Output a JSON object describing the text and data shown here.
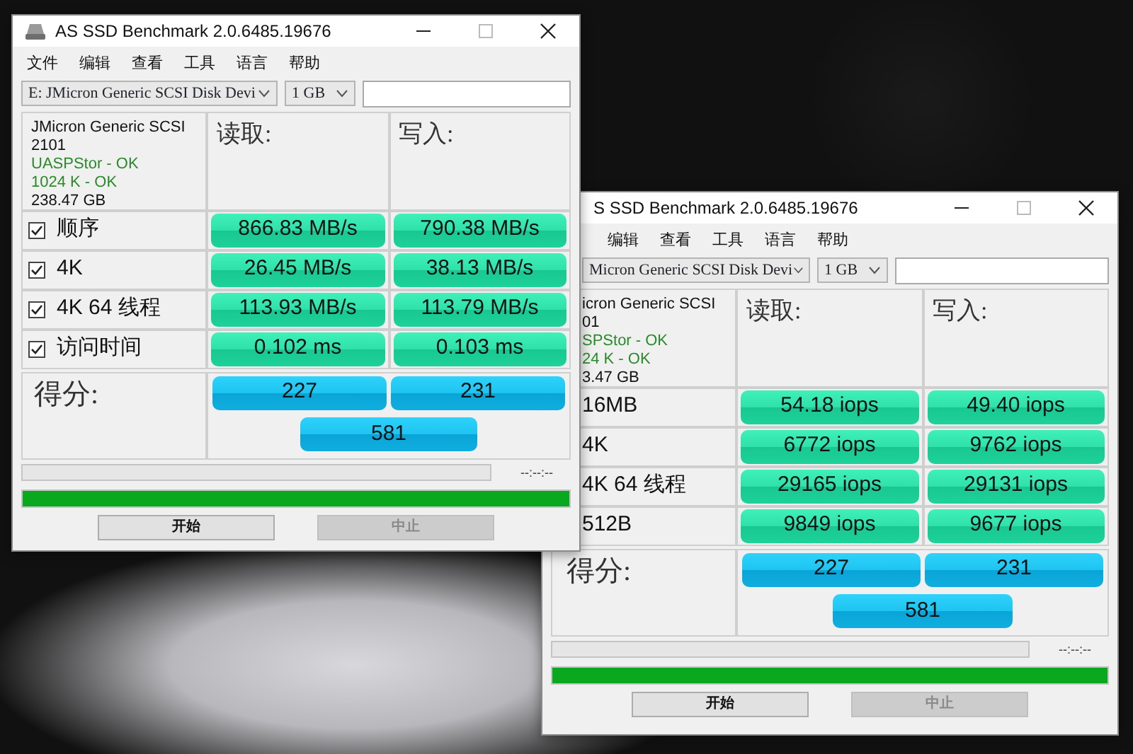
{
  "windows": [
    {
      "title": "AS SSD Benchmark 2.0.6485.19676",
      "menu": [
        "文件",
        "编辑",
        "查看",
        "工具",
        "语言",
        "帮助"
      ],
      "drive": "E: JMicron Generic SCSI Disk Devi",
      "size": "1 GB",
      "info": [
        {
          "text": "JMicron Generic SCSI",
          "ok": false
        },
        {
          "text": "2101",
          "ok": false
        },
        {
          "text": "UASPStor - OK",
          "ok": true
        },
        {
          "text": "1024 K - OK",
          "ok": true
        },
        {
          "text": "238.47 GB",
          "ok": false
        }
      ],
      "columns": [
        "读取:",
        "写入:"
      ],
      "rows": [
        {
          "label": "顺序",
          "checked": true,
          "read": "866.83 MB/s",
          "write": "790.38 MB/s"
        },
        {
          "label": "4K",
          "checked": true,
          "read": "26.45 MB/s",
          "write": "38.13 MB/s"
        },
        {
          "label": "4K 64 线程",
          "checked": true,
          "read": "113.93 MB/s",
          "write": "113.79 MB/s"
        },
        {
          "label": "访问时间",
          "checked": true,
          "read": "0.102 ms",
          "write": "0.103 ms"
        }
      ],
      "score": {
        "label": "得分:",
        "read": "227",
        "write": "231",
        "total": "581"
      },
      "elapsed": "--:--:--",
      "progress": [
        {
          "level": 0
        },
        {
          "level": 1
        }
      ],
      "buttons": [
        {
          "label": "开始",
          "disabled": false
        },
        {
          "label": "中止",
          "disabled": true
        }
      ]
    },
    {
      "title": "S SSD Benchmark 2.0.6485.19676",
      "menu": [
        "编辑",
        "查看",
        "工具",
        "语言",
        "帮助"
      ],
      "drive": "Micron Generic SCSI Disk Devi",
      "size": "1 GB",
      "info": [
        {
          "text": "icron Generic SCSI",
          "ok": false
        },
        {
          "text": "01",
          "ok": false
        },
        {
          "text": "SPStor - OK",
          "ok": true
        },
        {
          "text": "24 K - OK",
          "ok": true
        },
        {
          "text": "3.47 GB",
          "ok": false
        }
      ],
      "columns": [
        "读取:",
        "写入:"
      ],
      "rows": [
        {
          "label": "16MB",
          "read": "54.18 iops",
          "write": "49.40 iops"
        },
        {
          "label": "4K",
          "read": "6772 iops",
          "write": "9762 iops"
        },
        {
          "label": "4K 64 线程",
          "read": "29165 iops",
          "write": "29131 iops"
        },
        {
          "label": "512B",
          "read": "9849 iops",
          "write": "9677 iops"
        }
      ],
      "score": {
        "label": "得分:",
        "read": "227",
        "write": "231",
        "total": "581"
      },
      "elapsed": "--:--:--",
      "progress": [
        {
          "level": 0
        },
        {
          "level": 1
        }
      ],
      "buttons": [
        {
          "label": "开始",
          "disabled": false
        },
        {
          "label": "中止",
          "disabled": true
        }
      ]
    }
  ]
}
